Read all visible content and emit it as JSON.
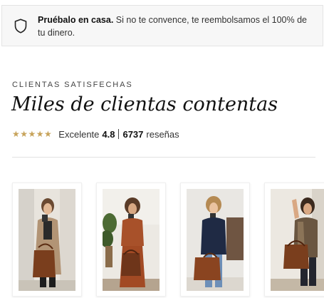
{
  "banner": {
    "icon": "shield-icon",
    "bold_text": "Pruébalo en casa.",
    "text": " Si no te convence, te reembolsamos el 100% de tu dinero."
  },
  "reviews": {
    "eyebrow": "CLIENTAS SATISFECHAS",
    "headline": "Miles de clientas contentas",
    "stars": "★★★★★",
    "rating_word": "Excelente",
    "rating_value": "4.8",
    "review_count": "6737",
    "reviews_word": "reseñas"
  },
  "colors": {
    "star": "#c7a35a",
    "bag": "#7a3e1d"
  },
  "gallery": [
    "customer-photo-1",
    "customer-photo-2",
    "customer-photo-3",
    "customer-photo-4"
  ]
}
